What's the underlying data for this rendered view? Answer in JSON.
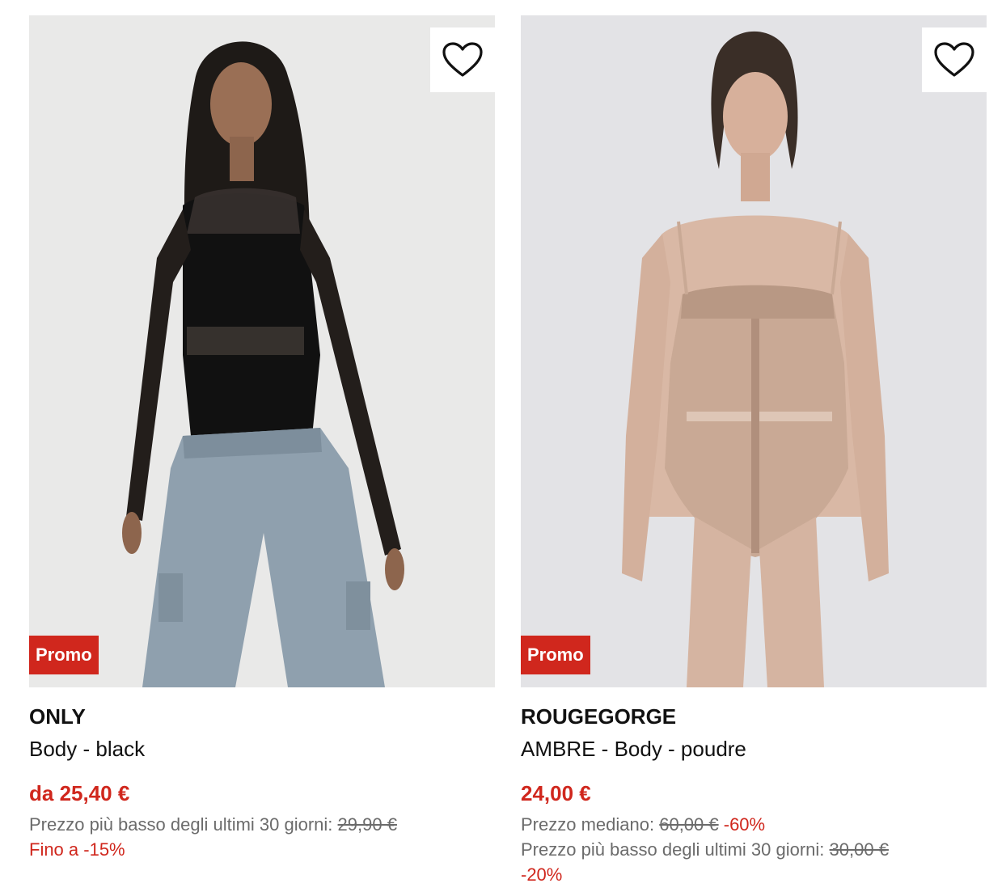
{
  "products": [
    {
      "brand": "ONLY",
      "name": "Body - black",
      "badge": "Promo",
      "price": "da 25,40 €",
      "lowest_label": "Prezzo più basso degli ultimi 30 giorni:",
      "lowest_value": "29,90 €",
      "discount_text": "Fino a -15%",
      "wishlist_icon": "heart-outline-icon"
    },
    {
      "brand": "ROUGEGORGE",
      "name": "AMBRE - Body - poudre",
      "badge": "Promo",
      "price": "24,00 €",
      "median_label": "Prezzo mediano:",
      "median_value": "60,00 €",
      "median_discount": "-60%",
      "lowest_label": "Prezzo più basso degli ultimi 30 giorni:",
      "lowest_value": "30,00 €",
      "lowest_discount": "-20%",
      "wishlist_icon": "heart-outline-icon"
    }
  ],
  "colors": {
    "accent_red": "#d0271d",
    "text_primary": "#111111",
    "text_secondary": "#6b6b6b"
  }
}
